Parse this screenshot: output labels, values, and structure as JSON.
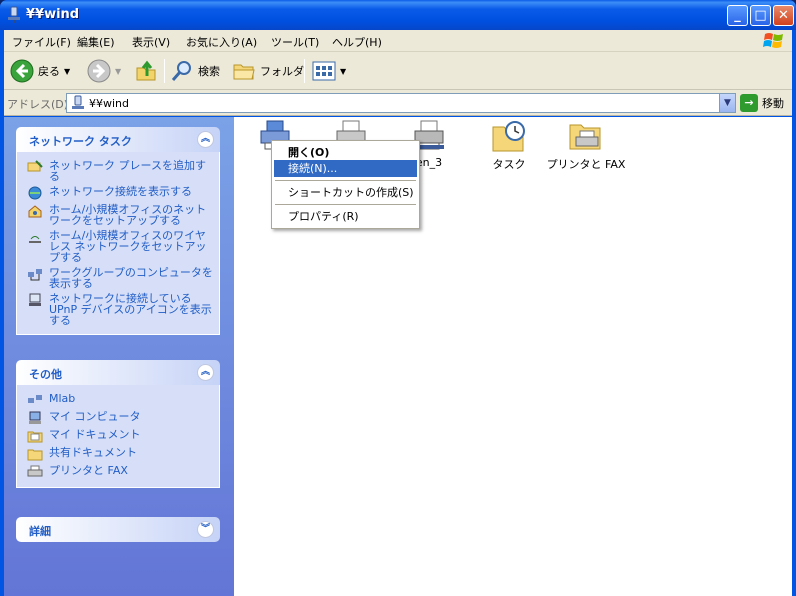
{
  "window": {
    "title": "¥¥wind"
  },
  "menubar": {
    "items": [
      "ファイル(F)",
      "編集(E)",
      "表示(V)",
      "お気に入り(A)",
      "ツール(T)",
      "ヘルプ(H)"
    ]
  },
  "toolbar": {
    "back_label": "戻る",
    "search_label": "検索",
    "folders_label": "フォルダ"
  },
  "address": {
    "label": "アドレス(D)",
    "value": "¥¥wind",
    "go_label": "移動"
  },
  "tasks_panel": {
    "title": "ネットワーク タスク",
    "items": [
      "ネットワーク プレースを追加する",
      "ネットワーク接続を表示する",
      "ホーム/小規模オフィスのネットワークをセットアップする",
      "ホーム/小規模オフィスのワイヤレス ネットワークをセットアップする",
      "ワークグループのコンピュータを表示する",
      "ネットワークに接続している UPnP デバイスのアイコンを表示する"
    ]
  },
  "other_panel": {
    "title": "その他",
    "items": [
      "Mlab",
      "マイ コンピュータ",
      "マイ ドキュメント",
      "共有ドキュメント",
      "プリンタと FAX"
    ]
  },
  "details_panel": {
    "title": "詳細"
  },
  "files": [
    {
      "name": "",
      "icon": "printer-icon"
    },
    {
      "name": "",
      "icon": "printer-icon"
    },
    {
      "name": "en_3",
      "icon": "printer-icon"
    },
    {
      "name": "タスク",
      "icon": "scheduled-tasks-folder-icon"
    },
    {
      "name": "プリンタと FAX",
      "icon": "printers-folder-icon"
    }
  ],
  "context_menu": {
    "items": [
      "開く(O)",
      "接続(N)...",
      "ショートカットの作成(S)",
      "プロパティ(R)"
    ]
  }
}
